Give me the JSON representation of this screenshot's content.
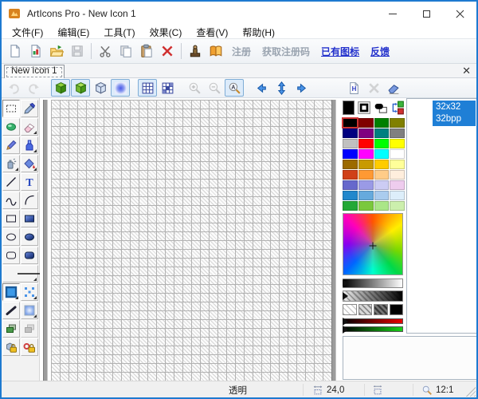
{
  "window": {
    "title": "ArtIcons Pro - New Icon 1"
  },
  "menu": {
    "items": [
      "文件(F)",
      "编辑(E)",
      "工具(T)",
      "效果(C)",
      "查看(V)",
      "帮助(H)"
    ]
  },
  "toolbar": {
    "buttons": [
      {
        "name": "new-icon",
        "icon": "page-new"
      },
      {
        "name": "new-from-image",
        "icon": "page-image"
      },
      {
        "name": "open",
        "icon": "folder-open"
      },
      {
        "name": "save",
        "icon": "floppy",
        "disabled": true
      },
      {
        "sep": true
      },
      {
        "name": "cut",
        "icon": "scissors"
      },
      {
        "name": "copy",
        "icon": "copy"
      },
      {
        "name": "paste",
        "icon": "paste"
      },
      {
        "name": "delete",
        "icon": "delete-x"
      },
      {
        "sep": true
      },
      {
        "name": "register-tool",
        "icon": "stamp"
      },
      {
        "name": "help-book",
        "icon": "book"
      }
    ],
    "links": [
      {
        "name": "register",
        "label": "注册",
        "enabled": false
      },
      {
        "name": "get-registration-code",
        "label": "获取注册码",
        "enabled": false
      },
      {
        "name": "existing-icons",
        "label": "已有图标",
        "enabled": true
      },
      {
        "name": "feedback",
        "label": "反馈",
        "enabled": true
      }
    ]
  },
  "tab": {
    "label": "New Icon 1",
    "close_glyph": "✕"
  },
  "editbar": {
    "left_buttons": [
      {
        "name": "undo",
        "icon": "undo",
        "disabled": true
      },
      {
        "name": "redo",
        "icon": "redo",
        "disabled": true
      },
      {
        "gap": true
      },
      {
        "name": "draw-normal-mode",
        "icon": "cube-green",
        "checked": true
      },
      {
        "name": "draw-filled-mode",
        "icon": "cube-green2",
        "checked": true
      },
      {
        "name": "view-3d",
        "icon": "cube-3d"
      },
      {
        "name": "smooth-view",
        "icon": "blur",
        "checked": true
      },
      {
        "gap": true
      },
      {
        "name": "show-grid",
        "icon": "grid",
        "checked": true
      },
      {
        "name": "grid-style",
        "icon": "grid2"
      },
      {
        "gap": true
      },
      {
        "name": "zoom-in",
        "icon": "zoom-in",
        "disabled": true
      },
      {
        "name": "zoom-out",
        "icon": "zoom-out",
        "disabled": true
      },
      {
        "name": "zoom-actual",
        "icon": "zoom-a",
        "checked": true
      },
      {
        "gap": true
      },
      {
        "name": "shift-left",
        "icon": "arrow-left"
      },
      {
        "name": "shift-vertical",
        "icon": "arrow-updown"
      },
      {
        "name": "shift-right",
        "icon": "arrow-right"
      }
    ],
    "right_buttons": [
      {
        "name": "new-image-format",
        "icon": "page-h"
      },
      {
        "name": "delete-image-format",
        "icon": "x-gray",
        "disabled": true
      },
      {
        "name": "test-icon",
        "icon": "eraser-blue"
      }
    ]
  },
  "tools": {
    "items": [
      {
        "name": "select",
        "icon": "marquee",
        "state": "active"
      },
      {
        "name": "color-picker",
        "icon": "eyedropper"
      },
      {
        "name": "smooth-tool",
        "icon": "gem"
      },
      {
        "name": "eraser",
        "icon": "eraser",
        "corner": true
      },
      {
        "name": "pencil",
        "icon": "pencil"
      },
      {
        "name": "pen",
        "icon": "ink",
        "corner": true
      },
      {
        "name": "spray",
        "icon": "spray",
        "corner": true
      },
      {
        "name": "fill",
        "icon": "fill",
        "corner": true
      },
      {
        "name": "line",
        "icon": "line"
      },
      {
        "name": "text",
        "icon": "text"
      },
      {
        "name": "curve",
        "icon": "curve"
      },
      {
        "name": "arc",
        "icon": "arc"
      },
      {
        "name": "rectangle",
        "icon": "rect"
      },
      {
        "name": "filled-rectangle",
        "icon": "rect-f"
      },
      {
        "name": "ellipse",
        "icon": "ellipse"
      },
      {
        "name": "filled-ellipse",
        "icon": "ellipse-f"
      },
      {
        "name": "rounded-rectangle",
        "icon": "rrect"
      },
      {
        "name": "filled-rounded-rectangle",
        "icon": "rrect-f"
      },
      {
        "name": "line-width",
        "icon": "line-w",
        "wide": true,
        "corner": true
      },
      {
        "name": "active-color-mode",
        "icon": "color-sq",
        "state": "active",
        "corner": true
      },
      {
        "name": "scatter",
        "icon": "scatter",
        "corner": true
      },
      {
        "name": "smooth-line",
        "icon": "smooth-line"
      },
      {
        "name": "gradient",
        "icon": "gradient-sq",
        "corner": true
      },
      {
        "name": "copy-area",
        "icon": "copy-green"
      },
      {
        "name": "paste-area",
        "icon": "copy-gray",
        "disabled": true
      },
      {
        "name": "lock-drawing",
        "icon": "lock-cube"
      },
      {
        "name": "lock-colors",
        "icon": "lock-color"
      }
    ]
  },
  "colorpanel": {
    "current": [
      {
        "name": "foreground-color",
        "color": "#000000"
      },
      {
        "name": "border-fill-mode",
        "icon": "border-mode"
      },
      {
        "name": "foreground-background",
        "icon": "fgbg"
      },
      {
        "name": "swap-colors",
        "icon": "swap"
      }
    ],
    "palette": [
      "#000000",
      "#800000",
      "#008000",
      "#808000",
      "#000080",
      "#800080",
      "#008080",
      "#808080",
      "#c0c0c0",
      "#ff0000",
      "#00ff00",
      "#ffff00",
      "#0000ff",
      "#ff00ff",
      "#00ffff",
      "#ffffff",
      "#9c6a00",
      "#c89a00",
      "#ffcc00",
      "#ffff99",
      "#d04018",
      "#ff9933",
      "#ffcc88",
      "#ffeedd",
      "#6668cc",
      "#9a9ae6",
      "#ccccf4",
      "#eeccee",
      "#2288cc",
      "#66aadd",
      "#aaccee",
      "#ddeefa",
      "#22a836",
      "#7ac83c",
      "#aae688",
      "#ccefad"
    ],
    "selected_index": 0,
    "hatch_swatches": [
      "h-light",
      "h-gray",
      "h-dark",
      "h-black"
    ]
  },
  "format_list": {
    "items": [
      {
        "size": "32x32",
        "depth": "32bpp",
        "selected": true
      }
    ]
  },
  "statusbar": {
    "transparency": "透明",
    "position": "24,0",
    "zoom": "12:1"
  }
}
